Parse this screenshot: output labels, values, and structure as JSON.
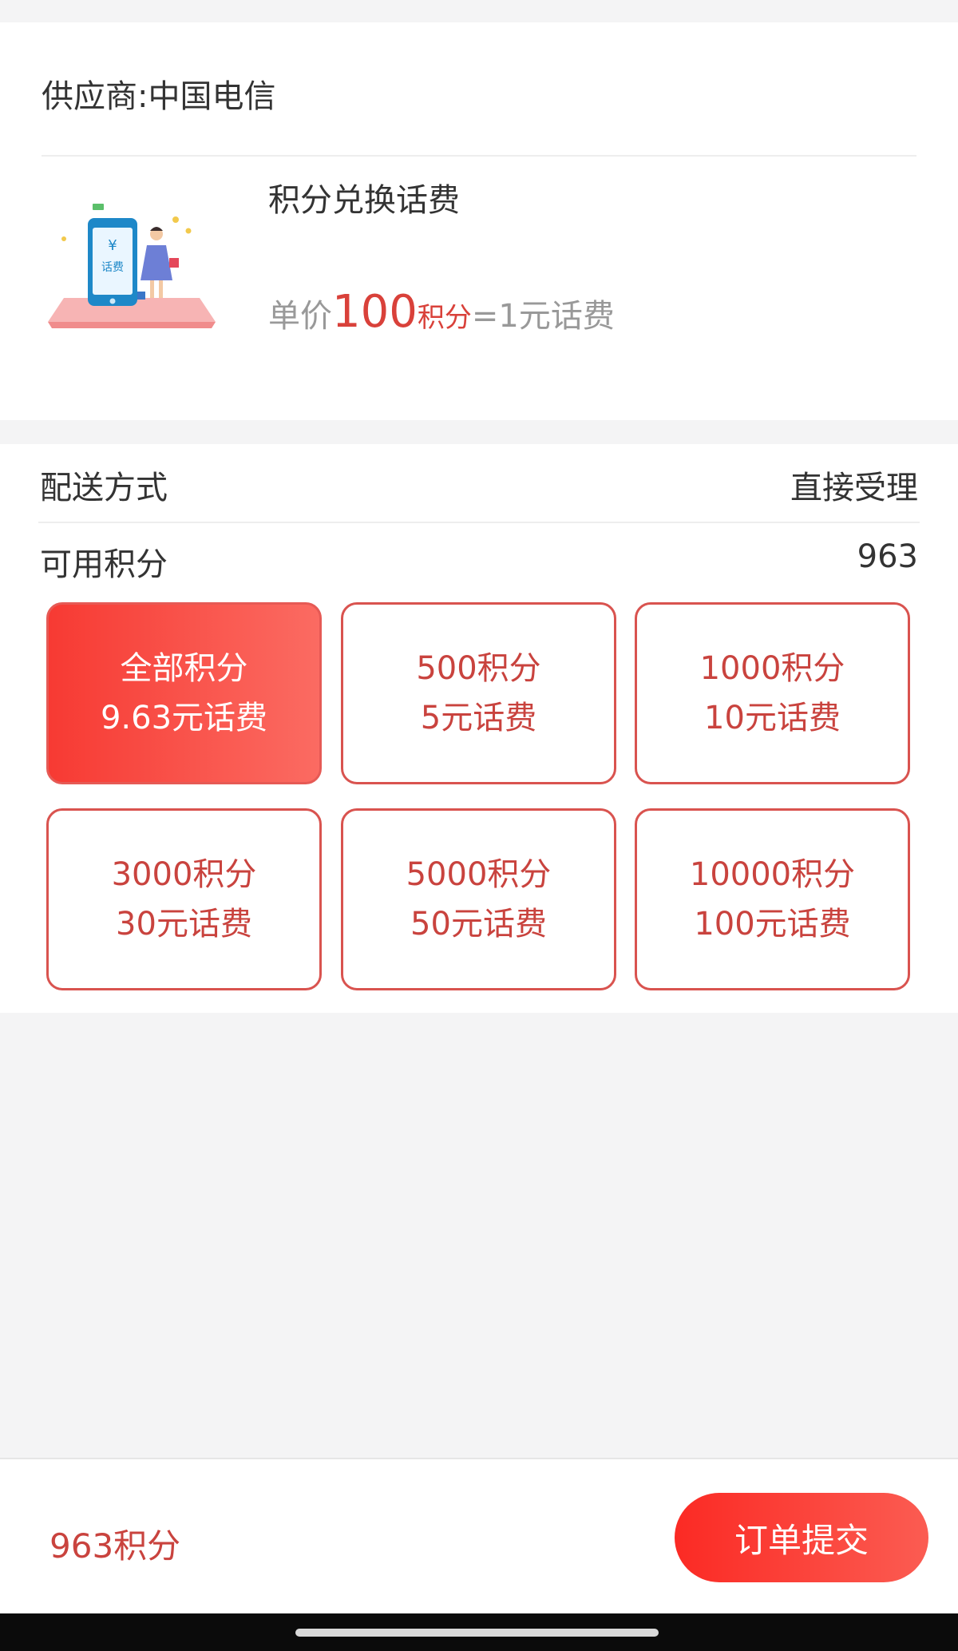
{
  "supplier": {
    "label": "供应商:",
    "name": "中国电信"
  },
  "product": {
    "title": "积分兑换话费",
    "image_alt": "phone-bill-illustration",
    "image_text": "话费",
    "price_prefix": "单价",
    "price_value": "100",
    "price_unit": "积分",
    "price_suffix": "=1元话费"
  },
  "delivery": {
    "label": "配送方式",
    "value": "直接受理"
  },
  "points": {
    "label": "可用积分",
    "value": "963"
  },
  "options": [
    {
      "line1": "全部积分",
      "line2": "9.63元话费",
      "selected": true
    },
    {
      "line1": "500积分",
      "line2": "5元话费",
      "selected": false
    },
    {
      "line1": "1000积分",
      "line2": "10元话费",
      "selected": false
    },
    {
      "line1": "3000积分",
      "line2": "30元话费",
      "selected": false
    },
    {
      "line1": "5000积分",
      "line2": "50元话费",
      "selected": false
    },
    {
      "line1": "10000积分",
      "line2": "100元话费",
      "selected": false
    }
  ],
  "footer": {
    "total": "963积分",
    "submit_label": "订单提交"
  },
  "colors": {
    "accent": "#d9413a",
    "gradient_start": "#f73a33",
    "gradient_end": "#fb6b62",
    "background": "#f4f4f5"
  }
}
